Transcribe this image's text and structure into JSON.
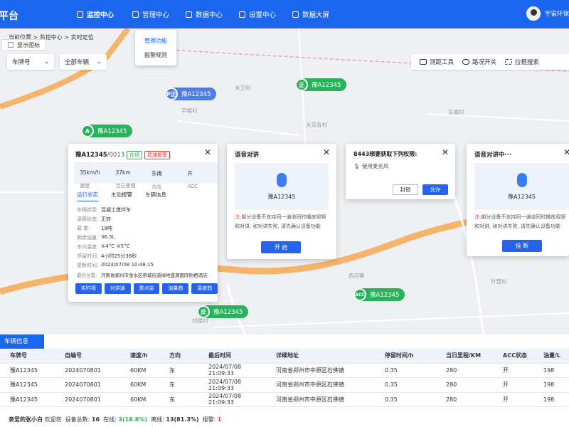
{
  "header": {
    "logo": "平台",
    "nav": [
      {
        "label": "监控中心",
        "icon": "monitor-icon",
        "active": true
      },
      {
        "label": "管理中心",
        "icon": "shield-icon",
        "active": false
      },
      {
        "label": "数据中心",
        "icon": "chart-icon",
        "active": false
      },
      {
        "label": "设置中心",
        "icon": "gear-icon",
        "active": false
      },
      {
        "label": "数据大屏",
        "icon": "screen-icon",
        "active": false
      }
    ],
    "user": "宇宙环保"
  },
  "dropdown": {
    "items": [
      "管理功能",
      "报警规则"
    ]
  },
  "breadcrumb": "当前位置 > 监控中心 > 实时定位",
  "map": {
    "show_icon_label": "显示图标",
    "plate_select": "车牌号",
    "vehicle_select": "全部车辆",
    "tools": [
      {
        "label": "测距工具",
        "icon": "ruler-icon"
      },
      {
        "label": "路况开关",
        "icon": "traffic-icon"
      },
      {
        "label": "拉框搜索",
        "icon": "box-select-icon"
      }
    ],
    "places": [
      "未王村",
      "大苏各村",
      "西河寨",
      "针营村",
      "小渡村",
      "蔡河村",
      "东城村",
      "杏王村",
      "乔庄",
      "宇楼村",
      "刘楼村"
    ],
    "markers": [
      {
        "plate": "豫A12345",
        "tag": "P正",
        "color": "blue"
      },
      {
        "plate": "豫A12345",
        "tag": "正",
        "color": "green"
      },
      {
        "plate": "豫A12345",
        "tag": "A",
        "color": "green"
      },
      {
        "plate": "豫A12345",
        "tag": "ACC",
        "color": "green"
      },
      {
        "plate": "豫A12345",
        "tag": "反",
        "color": "green"
      }
    ]
  },
  "vehicle_card": {
    "plate": "豫A12345",
    "id": "/0013",
    "status_online": "在线",
    "status_alarm": "超速报警",
    "stats": [
      {
        "value": "35km/h",
        "label": "速度"
      },
      {
        "value": "37km",
        "label": "当日里程"
      },
      {
        "value": "东南",
        "label": "方向"
      },
      {
        "value": "开",
        "label": "ACC"
      }
    ],
    "tabs": [
      "运行状态",
      "主动报警",
      "车辆信息"
    ],
    "fields": [
      {
        "k": "车辆类型:",
        "v": "混凝土搅拌车"
      },
      {
        "k": "滚筒状态:",
        "v": "正转"
      },
      {
        "k": "载 重:",
        "v": "18吨"
      },
      {
        "k": "剩余油量:",
        "v": "36.5L"
      },
      {
        "k": "车内温度:",
        "v": "①4°C  ②5°C"
      },
      {
        "k": "停留时间:",
        "v": "4小时25分36秒"
      },
      {
        "k": "更新时间:",
        "v": "2024/07/08 10:48:15"
      },
      {
        "k": "最后位置:",
        "v": "河南省郑州市金水区祭城街道绿地盛源国际贻栖酒店"
      }
    ],
    "buttons": [
      "实时视频",
      "对讲通话",
      "重点监控",
      "油量曲线",
      "温度曲线"
    ]
  },
  "voice_card": {
    "title": "语音对讲",
    "plate": "豫A12345",
    "note_prefix": "注:",
    "note": "部分设备不支持同一通道同时播放视频和对讲, 如对讲失败, 请先确认设备功能",
    "button": "开 启"
  },
  "permission_card": {
    "title": "8443想要获取下列权限:",
    "item": "使用麦克风",
    "deny": "封锁",
    "allow": "允许"
  },
  "calling_card": {
    "title": "语音对讲中···",
    "plate": "豫A12345",
    "note_prefix": "注:",
    "note": "部分设备不支持同一通道同时播放视频和对讲, 如对讲失败, 请先确认设备功能",
    "button": "挂 断"
  },
  "table": {
    "tab": "车辆信息",
    "headers": [
      "车牌号",
      "自编号",
      "速度/h",
      "方向",
      "最后时间",
      "详细地址",
      "停留时间/h",
      "当日里程/KM",
      "ACC状态",
      "油量/L"
    ],
    "rows": [
      [
        "豫A12345",
        "2024070801",
        "60KM",
        "东",
        "2024/07/08 21:09:33",
        "河南省郑州市中原区石佛镇",
        "0.35",
        "280",
        "开",
        "198"
      ],
      [
        "豫A12345",
        "2024070801",
        "60KM",
        "东",
        "2024/07/08 21:09:33",
        "河南省郑州市中原区石佛镇",
        "0.35",
        "280",
        "开",
        "198"
      ],
      [
        "豫A12345",
        "2024070801",
        "60KM",
        "东",
        "2024/07/08 21:09:33",
        "河南省郑州市中原区石佛镇",
        "0.35",
        "280",
        "开",
        "198"
      ]
    ]
  },
  "status_bar": {
    "greeting": "亲爱的张小白",
    "welcome": "欢迎您",
    "total_label": "设备总数:",
    "total": "16",
    "online_label": "在线:",
    "online": "3(18.8%)",
    "offline_label": "离线:",
    "offline": "13(81.3%)",
    "alarm_label": "报警:",
    "alarm": "1"
  },
  "colors": {
    "primary": "#1a66ee",
    "online": "#28b35a",
    "alarm": "#e33333"
  }
}
